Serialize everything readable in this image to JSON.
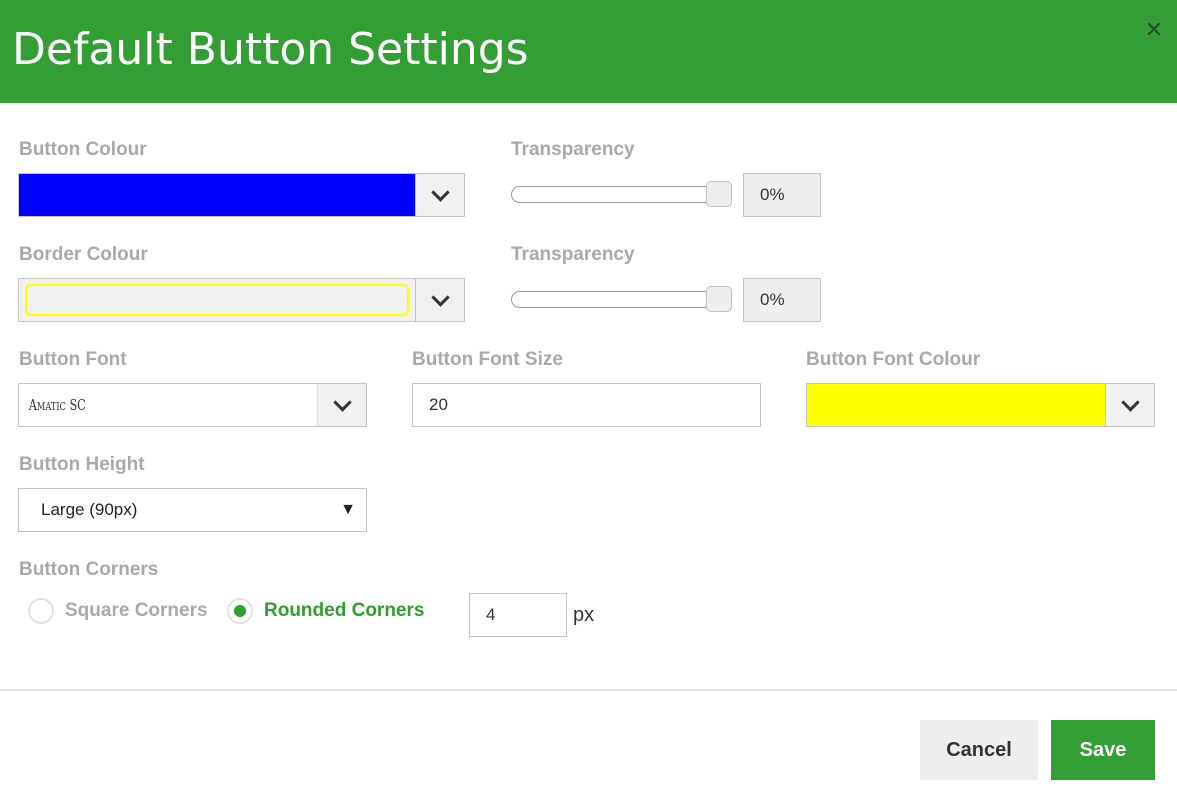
{
  "dialog": {
    "title": "Default Button Settings"
  },
  "button_colour": {
    "label": "Button Colour",
    "color": "#0000ff"
  },
  "button_transparency": {
    "label": "Transparency",
    "value": "0%",
    "level": 0
  },
  "border_colour": {
    "label": "Border Colour",
    "color": "#f0f0f0",
    "inner_border": "#ffff00"
  },
  "border_transparency": {
    "label": "Transparency",
    "value": "0%",
    "level": 0
  },
  "font": {
    "label": "Button Font",
    "value": "Amatic SC"
  },
  "font_size": {
    "label": "Button Font Size",
    "value": "20"
  },
  "font_colour": {
    "label": "Button Font Colour",
    "color": "#ffff00"
  },
  "height": {
    "label": "Button Height",
    "value": "Large (90px)"
  },
  "corners": {
    "label": "Button Corners",
    "square_label": "Square Corners",
    "rounded_label": "Rounded Corners",
    "selected": "rounded",
    "radius_value": "4",
    "unit": "px"
  },
  "footer": {
    "cancel_label": "Cancel",
    "save_label": "Save"
  },
  "colors": {
    "brand_green": "#339e33",
    "label_grey": "#a9a9a9",
    "selected_radio_text": "#2f9e2f"
  },
  "icons": {
    "close": "close-icon",
    "dropdown": "chevron-down-icon",
    "select": "triangle-down-icon"
  }
}
